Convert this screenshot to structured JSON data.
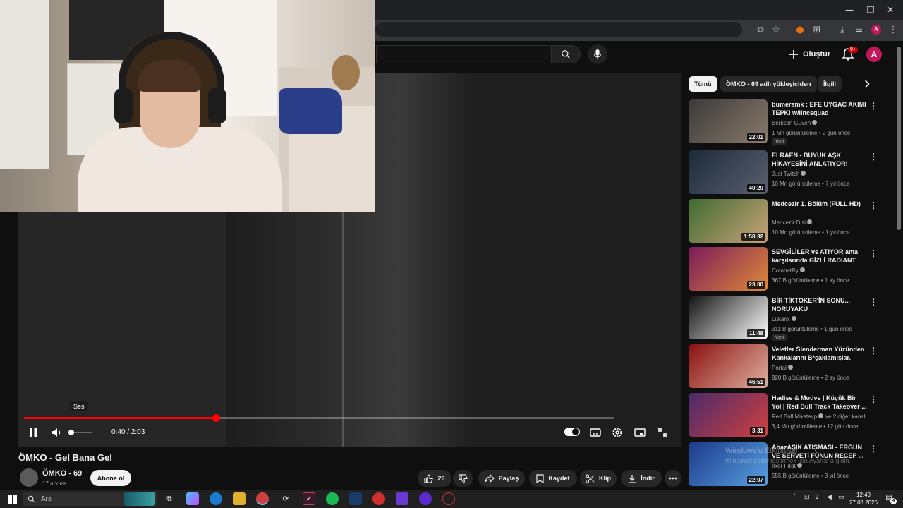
{
  "browser": {
    "win_minimize": "—",
    "win_restore": "❐",
    "win_close": "✕",
    "profile_initial": "A"
  },
  "header": {
    "create_label": "Oluştur",
    "notif_count": "9+",
    "avatar_initial": "A"
  },
  "player": {
    "tooltip": "Ses",
    "time": "0:40 / 2:03",
    "progress_fraction": 0.325,
    "volume_fraction": 0.15
  },
  "video": {
    "title": "ÖMKO - Gel Bana Gel",
    "channel": "ÖMKO - 69",
    "subscribers": "17 abone",
    "subscribe_label": "Abone ol",
    "like_count": "26",
    "share_label": "Paylaş",
    "save_label": "Kaydet",
    "clip_label": "Klip",
    "download_label": "İndir"
  },
  "chips": [
    {
      "label": "Tümü"
    },
    {
      "label": "ÖMKO - 69 adlı yükleyiciden"
    },
    {
      "label": "İlgili"
    }
  ],
  "recommendations": [
    {
      "title": "bumeramk : EFE UYGAC AKIMI TEPKI w/lincsquad",
      "channel": "Berkcan Güven",
      "meta": "1 Mn görüntüleme • 2 gün önce",
      "badge": "Yeni",
      "duration": "22:01",
      "color1": "#3a3a3a",
      "color2": "#8a7a6a"
    },
    {
      "title": "ELRAEN - BÜYÜK AŞK HİKAYESİNİ ANLATIYOR!",
      "channel": "Just Twitch",
      "meta": "10 Mn görüntüleme • 7 yıl önce",
      "badge": "",
      "duration": "40:29",
      "color1": "#1c2a3a",
      "color2": "#5a6070"
    },
    {
      "title": "Medcezir 1. Bölüm (FULL HD)",
      "channel": "Medcezir Dizi",
      "meta": "10 Mn görüntüleme • 1 yıl önce",
      "badge": "",
      "duration": "1:58:32",
      "color1": "#3e6b2e",
      "color2": "#c9a27a"
    },
    {
      "title": "SEVGİLİLER vs ATIYOR ama karşılarında GİZLİ RADIANT va...",
      "channel": "CombatRy",
      "meta": "367 B görüntüleme • 1 ay önce",
      "badge": "",
      "duration": "23:00",
      "color1": "#7a1a5a",
      "color2": "#e08a3a"
    },
    {
      "title": "BİR TİKTOKER'İN SONU... NORUYAKU",
      "channel": "Lukarix",
      "meta": "311 B görüntüleme • 1 gün önce",
      "badge": "Yeni",
      "duration": "11:48",
      "color1": "#111111",
      "color2": "#ffffff"
    },
    {
      "title": "Veletler Slenderman Yüzünden Kankalarını B*çaklamışlar.",
      "channel": "Portal",
      "meta": "920 B görüntüleme • 2 ay önce",
      "badge": "",
      "duration": "46:51",
      "color1": "#8a1010",
      "color2": "#e0b0a0"
    },
    {
      "title": "Hadise & Motive | Küçük Bir Yol | Red Bull Track Takeover ...",
      "channel": "Red Bull Mikstevp",
      "channel_extra": "ve 2 diğer kanal",
      "meta": "3,4 Mn görüntüleme • 12 gün önce",
      "badge": "",
      "duration": "3:31",
      "color1": "#4a2a6a",
      "color2": "#d04040"
    },
    {
      "title": "AbazAŞIK ATIŞMASI - ERGÜN VE SERVETİ FÜNUN RECEP ...",
      "channel": "İlker Fırat",
      "meta": "555 B görüntüleme • 3 yıl önce",
      "badge": "",
      "duration": "22:07",
      "color1": "#1a3a8a",
      "color2": "#5aa0e0"
    }
  ],
  "watermark": {
    "line1": "Windows'u Etkinleştir",
    "line2": "Windows'u etkinleştirmek için Ayarlar'a gidin."
  },
  "taskbar": {
    "search_label": "Ara",
    "time": "12:49",
    "date": "27.03.2026",
    "notif_count": "4"
  },
  "colors": {
    "accent_red": "#ff0000",
    "background": "#0f0f0f"
  }
}
